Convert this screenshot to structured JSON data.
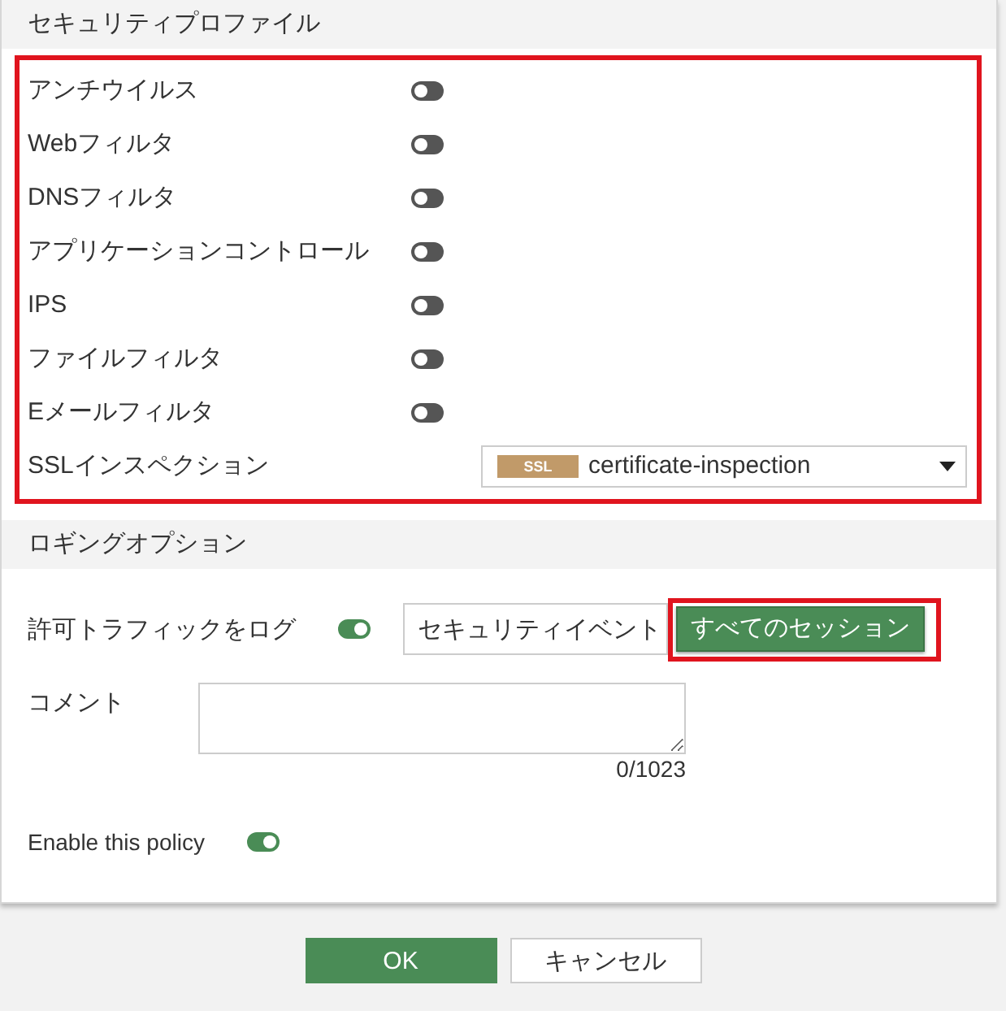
{
  "sections": [
    {
      "title": "セキュリティプロファイル",
      "highlighted": true,
      "rows": [
        {
          "kind": "toggle",
          "label": "アンチウイルス",
          "on": false
        },
        {
          "kind": "toggle",
          "label": "Webフィルタ",
          "on": false
        },
        {
          "kind": "toggle",
          "label": "DNSフィルタ",
          "on": false
        },
        {
          "kind": "toggle",
          "label": "アプリケーションコントロール",
          "on": false
        },
        {
          "kind": "toggle",
          "label": "IPS",
          "on": false
        },
        {
          "kind": "toggle",
          "label": "ファイルフィルタ",
          "on": false
        },
        {
          "kind": "toggle",
          "label": "Eメールフィルタ",
          "on": false
        },
        {
          "kind": "select",
          "label": "SSLインスペクション",
          "tag": "SSL",
          "value": "certificate-inspection"
        }
      ]
    },
    {
      "title": "ロギングオプション",
      "rows": [
        {
          "kind": "log",
          "label": "許可トラフィックをログ",
          "on": true,
          "options": [
            {
              "label": "セキュリティイベント",
              "selected": false,
              "highlighted": false
            },
            {
              "label": "すべてのセッション",
              "selected": true,
              "highlighted": true
            }
          ]
        },
        {
          "kind": "textarea",
          "label": "コメント",
          "counter": "0/1023"
        },
        {
          "kind": "toggle",
          "label": "Enable this policy",
          "on": true
        }
      ]
    }
  ],
  "buttons": [
    {
      "label": "OK",
      "primary": true
    },
    {
      "label": "キャンセル",
      "primary": false
    }
  ]
}
